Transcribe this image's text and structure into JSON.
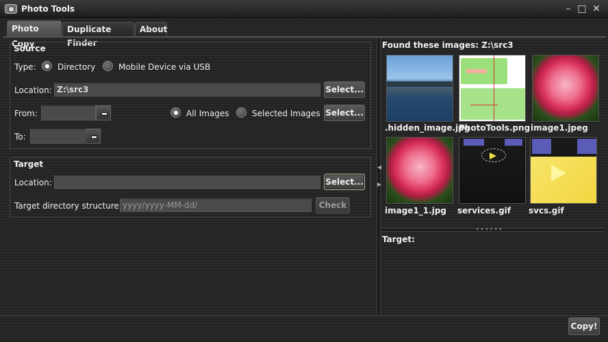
{
  "window": {
    "title": "Photo Tools"
  },
  "tabs": [
    {
      "label": "Photo Copy",
      "active": true
    },
    {
      "label": "Duplicate Finder",
      "active": false
    },
    {
      "label": "About",
      "active": false
    }
  ],
  "source": {
    "heading": "Source",
    "type_label": "Type:",
    "type_options": [
      "Directory",
      "Mobile Device via USB"
    ],
    "type_selected": "Directory",
    "location_label": "Location:",
    "location_value": "Z:\\src3",
    "select_label": "Select...",
    "from_label": "From:",
    "to_label": "To:",
    "scope_options": [
      "All Images",
      "Selected Images"
    ],
    "scope_selected": "All Images",
    "select2_label": "Select..."
  },
  "target": {
    "heading": "Target",
    "location_label": "Location:",
    "location_value": "",
    "select_label": "Select...",
    "structure_label": "Target directory structure:",
    "structure_placeholder": "yyyy/yyyy-MM-dd/",
    "check_label": "Check"
  },
  "right_panel": {
    "found_label": "Found these images: Z:\\src3",
    "images": [
      {
        "name": ".hidden_image.jpg",
        "kind": "seascape"
      },
      {
        "name": "PhotoTools.png",
        "kind": "diagram"
      },
      {
        "name": "image1.jpeg",
        "kind": "rose"
      },
      {
        "name": "image1_1.jpg",
        "kind": "rose"
      },
      {
        "name": "services.gif",
        "kind": "gif-diagram"
      },
      {
        "name": "svcs.gif",
        "kind": "gif-diagram-yellow"
      }
    ],
    "target_label": "Target:"
  },
  "footer": {
    "copy_label": "Copy!"
  },
  "colors": {
    "background": "#262626",
    "field": "#4a4a4a",
    "accent_border": "#b9b9a0"
  }
}
